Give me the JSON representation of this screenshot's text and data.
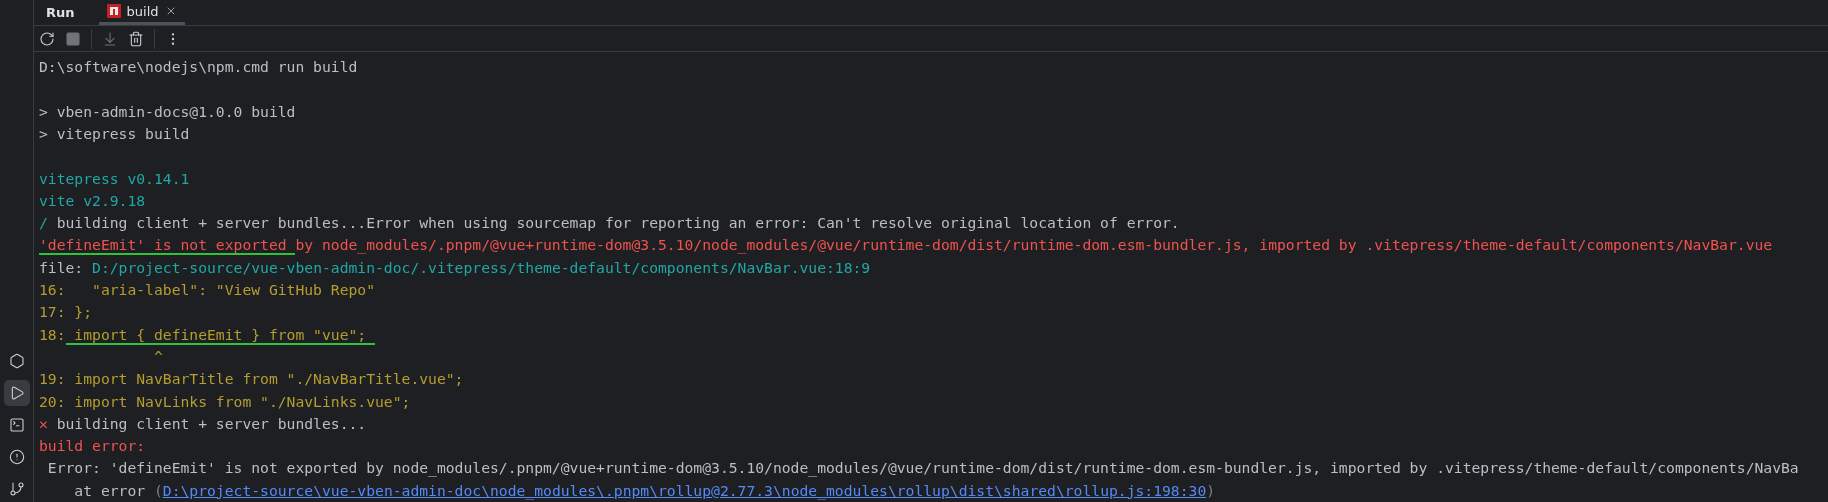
{
  "tool_window": {
    "title": "Run",
    "tabs": [
      {
        "label": "build",
        "selected": true
      }
    ]
  },
  "toolbar": [
    {
      "kind": "rerun",
      "disabled": false
    },
    {
      "kind": "stop",
      "disabled": true
    },
    {
      "kind": "separator"
    },
    {
      "kind": "scroll-end",
      "disabled": true
    },
    {
      "kind": "clear",
      "disabled": false
    },
    {
      "kind": "separator"
    },
    {
      "kind": "more",
      "disabled": false
    }
  ],
  "sidebar": [
    {
      "kind": "services",
      "selected": false
    },
    {
      "kind": "run",
      "selected": true
    },
    {
      "kind": "terminal",
      "selected": false
    },
    {
      "kind": "problems",
      "selected": false
    },
    {
      "kind": "git",
      "selected": false
    }
  ],
  "console": [
    {
      "segments": [
        {
          "text": "D:\\software\\nodejs\\npm.cmd run build",
          "kind": "plain"
        }
      ]
    },
    {
      "kind": "blank"
    },
    {
      "segments": [
        {
          "text": "> vben-admin-docs@1.0.0 build",
          "kind": "plain"
        }
      ]
    },
    {
      "segments": [
        {
          "text": "> vitepress build",
          "kind": "plain"
        }
      ]
    },
    {
      "kind": "blank"
    },
    {
      "segments": [
        {
          "text": "vitepress v0.14.1",
          "kind": "info"
        }
      ]
    },
    {
      "segments": [
        {
          "text": "vite v2.9.18",
          "kind": "info"
        }
      ]
    },
    {
      "segments": [
        {
          "text": "/",
          "kind": "info"
        },
        {
          "text": " building client + server bundles...Error when using sourcemap for reporting an error: Can't resolve original location of error.",
          "kind": "plain"
        }
      ]
    },
    {
      "segments": [
        {
          "text": "'defineEmit' is not exported ",
          "kind": "error",
          "marked": true
        },
        {
          "text": "by node_modules/.pnpm/@vue+runtime-dom@3.5.10/node_modules/@vue/runtime-dom/dist/runtime-dom.esm-bundler.js, imported by .vitepress/theme-default/components/NavBar.vue",
          "kind": "error"
        }
      ]
    },
    {
      "segments": [
        {
          "text": "file: ",
          "kind": "plain"
        },
        {
          "text": "D:/project-source/vue-vben-admin-doc/.vitepress/theme-default/components/NavBar.vue:18:9",
          "kind": "info"
        }
      ]
    },
    {
      "segments": [
        {
          "text": "16:   \"aria-label\": \"View GitHub Repo\"",
          "kind": "code"
        }
      ]
    },
    {
      "segments": [
        {
          "text": "17: };",
          "kind": "code"
        }
      ]
    },
    {
      "segments": [
        {
          "text": "18:",
          "kind": "code"
        },
        {
          "text": " import { defineEmit } from \"vue\"; ",
          "kind": "code",
          "marked": true
        }
      ]
    },
    {
      "segments": [
        {
          "text": "             ^",
          "kind": "code"
        }
      ]
    },
    {
      "segments": [
        {
          "text": "19: import NavBarTitle from \"./NavBarTitle.vue\";",
          "kind": "code"
        }
      ]
    },
    {
      "segments": [
        {
          "text": "20: import NavLinks from \"./NavLinks.vue\";",
          "kind": "code"
        }
      ]
    },
    {
      "segments": [
        {
          "text": "✕",
          "kind": "error"
        },
        {
          "text": " building client + server bundles...",
          "kind": "plain"
        }
      ]
    },
    {
      "segments": [
        {
          "text": "build error:",
          "kind": "error"
        }
      ]
    },
    {
      "segments": [
        {
          "text": " Error: 'defineEmit' is not exported by node_modules/.pnpm/@vue+runtime-dom@3.5.10/node_modules/@vue/runtime-dom/dist/runtime-dom.esm-bundler.js, imported by .vitepress/theme-default/components/NavBa",
          "kind": "plain"
        }
      ]
    },
    {
      "segments": [
        {
          "text": "    at error ",
          "kind": "plain"
        },
        {
          "text": "(",
          "kind": "muted"
        },
        {
          "text": "D:\\project-source\\vue-vben-admin-doc\\node_modules\\.pnpm\\rollup@2.77.3\\node_modules\\rollup\\dist\\shared\\rollup.js:198:30",
          "kind": "link"
        },
        {
          "text": ")",
          "kind": "muted"
        }
      ]
    }
  ]
}
